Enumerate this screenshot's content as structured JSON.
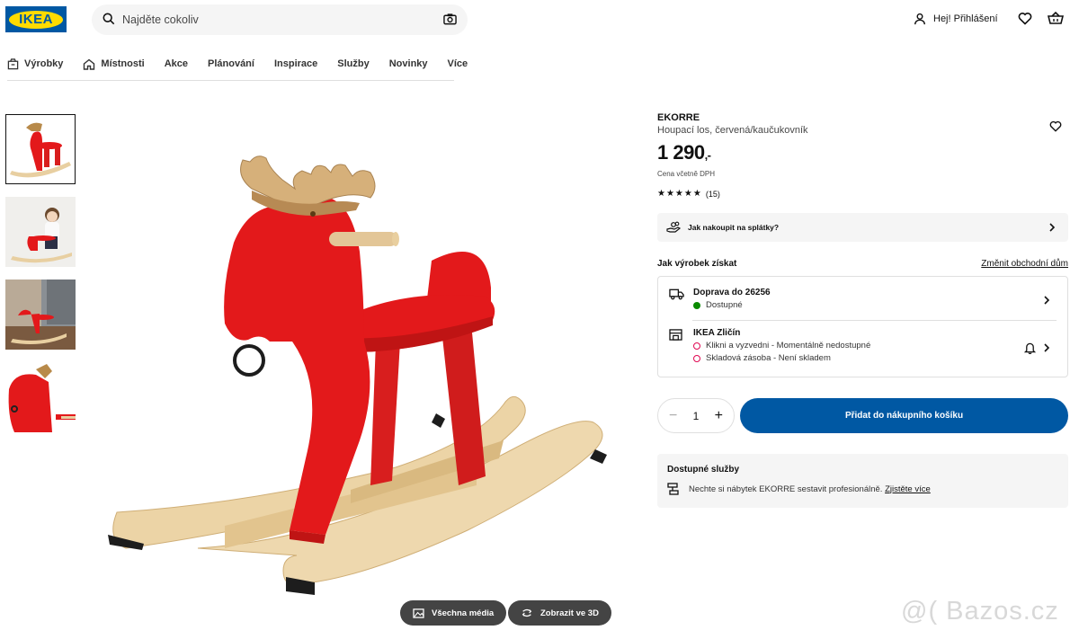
{
  "header": {
    "logo": "IKEA",
    "search_placeholder": "Najděte cokoliv",
    "login_label": "Hej! Přihlášení"
  },
  "nav": {
    "items": [
      {
        "label": "Výrobky",
        "icon": "box-icon"
      },
      {
        "label": "Místnosti",
        "icon": "house-icon"
      },
      {
        "label": "Akce"
      },
      {
        "label": "Plánování"
      },
      {
        "label": "Inspirace"
      },
      {
        "label": "Služby"
      },
      {
        "label": "Novinky"
      },
      {
        "label": "Více"
      }
    ]
  },
  "gallery": {
    "all_media_label": "Všechna média",
    "view_3d_label": "Zobrazit ve 3D"
  },
  "product": {
    "brand": "EKORRE",
    "description": "Houpací los, červená/kaučukovník",
    "price": "1 290",
    "price_suffix": ",-",
    "vat_note": "Cena včetně DPH",
    "rating_count": "(15)",
    "rating_stars": 5
  },
  "installment_banner": {
    "label": "Jak nakoupit na splátky?"
  },
  "fulfilment": {
    "heading": "Jak výrobek získat",
    "change_store": "Změnit obchodní dům",
    "delivery_title": "Doprava do 26256",
    "delivery_status": "Dostupné",
    "store_title": "IKEA Zličín",
    "store_line1": "Klikni a vyzvedni - Momentálně nedostupné",
    "store_line2": "Skladová zásoba - Není skladem"
  },
  "cart": {
    "quantity": "1",
    "add_label": "Přidat do nákupního košíku"
  },
  "services": {
    "heading": "Dostupné služby",
    "text": "Nechte si nábytek EKORRE sestavit profesionálně.",
    "link": "Zjistěte více"
  },
  "watermark": "@( Bazos.cz",
  "colors": {
    "brand_blue": "#0058a3",
    "brand_yellow": "#ffdb00",
    "moose_red": "#e3191b",
    "wood": "#e8cfa1",
    "available": "#0a8a00",
    "unavailable": "#e00751"
  }
}
